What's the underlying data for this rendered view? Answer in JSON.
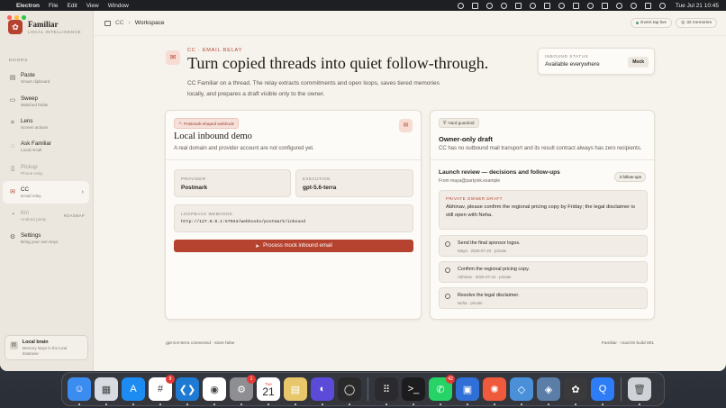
{
  "menubar": {
    "app": "Electron",
    "menus": [
      "File",
      "Edit",
      "View",
      "Window"
    ],
    "clock": "Tue Jul 21  10:45"
  },
  "sidebar": {
    "brand_name": "Familiar",
    "brand_tag": "LOCAL INTELLIGENCE",
    "section_label": "DOORS",
    "items": [
      {
        "title": "Paste",
        "sub": "Smart clipboard",
        "icon": "clipboard-icon"
      },
      {
        "title": "Sweep",
        "sub": "Watched folder",
        "icon": "folder-icon"
      },
      {
        "title": "Lens",
        "sub": "Screen actions",
        "icon": "lens-icon"
      },
      {
        "title": "Ask Familiar",
        "sub": "Local recall",
        "icon": "chat-icon"
      },
      {
        "title": "Pickup",
        "sub": "Phone relay",
        "icon": "phone-icon"
      },
      {
        "title": "CC",
        "sub": "Email relay",
        "icon": "mail-icon"
      },
      {
        "title": "Kin",
        "sub": "Android parity",
        "icon": "android-icon",
        "badge": "ROADMAP"
      },
      {
        "title": "Settings",
        "sub": "Bring your own keys",
        "icon": "gear-icon"
      }
    ],
    "local_brain": {
      "title": "Local brain",
      "sub": "Memory stays in the local database"
    }
  },
  "topbar": {
    "crumb_root": "CC",
    "crumb_current": "Workspace",
    "pill_event": "Event tap live",
    "pill_memories": "32 memories"
  },
  "hero": {
    "eyebrow": "CC · EMAIL RELAY",
    "title": "Turn copied threads into quiet follow-through.",
    "desc": "CC Familiar on a thread. The relay extracts commitments and open loops, saves tiered memories locally, and prepares a draft visible only to the owner."
  },
  "inbound_status": {
    "label": "INBOUND STATUS",
    "value": "Available everywhere",
    "button": "Mock"
  },
  "left_card": {
    "chip": "Postmark-shaped webhook",
    "title": "Local inbound demo",
    "desc": "A real domain and provider account are not configured yet.",
    "provider_label": "PROVIDER",
    "provider_value": "Postmark",
    "execution_label": "EXECUTION",
    "execution_value": "gpt-5.6-terra",
    "webhook_label": "LOOPBACK WEBHOOK",
    "webhook_value": "http://127.0.0.1:57043/webhooks/postmark/inbound",
    "button": "Process mock inbound email"
  },
  "right_card": {
    "chip": "Hard guardrail",
    "title": "Owner-only draft",
    "desc": "CC has no outbound mail transport and its result contract always has zero recipients.",
    "review_title": "Launch review — decisions and follow-ups",
    "review_from": "From maya@partyink.example",
    "followups": "3 follow-ups",
    "draft_label": "PRIVATE OWNER DRAFT",
    "draft_text": "Abhinav, please confirm the regional pricing copy by Friday; the legal disclaimer is still open with Neha.",
    "items": [
      {
        "title": "Send the final sponsor logos.",
        "meta": "Maya · 2026-07-23 · private"
      },
      {
        "title": "Confirm the regional pricing copy.",
        "meta": "Abhinav · 2026-07-24 · private"
      },
      {
        "title": "Resolve the legal disclaimer.",
        "meta": "Neha · private"
      }
    ]
  },
  "footer": {
    "left": "gpt-5.6-terra connected · store false",
    "right": "Familiar · macOS build 001"
  },
  "dock": {
    "apps": [
      {
        "name": "finder-app-icon",
        "color": "#3b8cf0",
        "glyph": "☺"
      },
      {
        "name": "launchpad-app-icon",
        "color": "#d8dbe2",
        "glyph": "▦"
      },
      {
        "name": "app-store-app-icon",
        "color": "#1d8cf2",
        "glyph": "A"
      },
      {
        "name": "slack-app-icon",
        "color": "#ffffff",
        "glyph": "#",
        "badge": "8"
      },
      {
        "name": "vscode-app-icon",
        "color": "#1f7ad3",
        "glyph": "❮❯"
      },
      {
        "name": "chrome-app-icon",
        "color": "#ffffff",
        "glyph": "◉"
      },
      {
        "name": "settings-app-icon",
        "color": "#8e8e93",
        "glyph": "⚙",
        "badge": "1"
      },
      {
        "name": "calendar-app-icon",
        "color": "#ffffff",
        "glyph": ""
      },
      {
        "name": "preview-app-icon",
        "color": "#e8c76a",
        "glyph": "▤"
      },
      {
        "name": "proton-app-icon",
        "color": "#5b4bd8",
        "glyph": "◐"
      },
      {
        "name": "ring-app-icon",
        "color": "#2a2a2a",
        "glyph": "◯"
      },
      {
        "name": "launcher-app-icon",
        "color": "#2b2b2f",
        "glyph": "⠿"
      },
      {
        "name": "terminal-app-icon",
        "color": "#1c1c1e",
        "glyph": ">_"
      },
      {
        "name": "whatsapp-app-icon",
        "color": "#25d366",
        "glyph": "✆",
        "badge": "42"
      },
      {
        "name": "db-app-icon",
        "color": "#2f6fd6",
        "glyph": "▣"
      },
      {
        "name": "burst-app-icon",
        "color": "#f05a3c",
        "glyph": "✺"
      },
      {
        "name": "cube-app-icon",
        "color": "#4a90d9",
        "glyph": "◇"
      },
      {
        "name": "cube2-app-icon",
        "color": "#5a7ea8",
        "glyph": "◈"
      },
      {
        "name": "chatgpt-app-icon",
        "color": "#3a3a3c",
        "glyph": "✿"
      },
      {
        "name": "q-app-icon",
        "color": "#2e7cf6",
        "glyph": "Q"
      },
      {
        "name": "trash-app-icon",
        "color": "#cfd3d8",
        "glyph": "🗑"
      }
    ],
    "calendar_month": "Tue",
    "calendar_day": "21"
  }
}
